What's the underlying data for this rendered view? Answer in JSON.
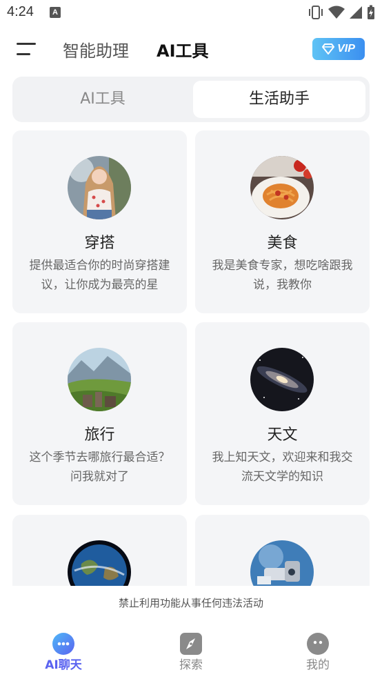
{
  "status_bar": {
    "time": "4:24",
    "notif_letter": "A"
  },
  "header": {
    "tabs": [
      {
        "label": "智能助理"
      },
      {
        "label": "AI工具"
      }
    ],
    "vip_label": "VIP"
  },
  "segment": {
    "items": [
      {
        "label": "AI工具"
      },
      {
        "label": "生活助手"
      }
    ],
    "active_index": 1
  },
  "cards": [
    {
      "title": "穿搭",
      "desc": "提供最适合你的时尚穿搭建议，让你成为最亮的星",
      "icon": "fashion-avatar"
    },
    {
      "title": "美食",
      "desc": "我是美食专家，想吃啥跟我说，我教你",
      "icon": "food-avatar"
    },
    {
      "title": "旅行",
      "desc": "这个季节去哪旅行最合适？问我就对了",
      "icon": "travel-avatar"
    },
    {
      "title": "天文",
      "desc": "我上知天文，欢迎来和我交流天文学的知识",
      "icon": "astronomy-avatar"
    },
    {
      "title": "",
      "desc": "",
      "icon": "earth-avatar"
    },
    {
      "title": "",
      "desc": "",
      "icon": "space-avatar"
    }
  ],
  "notice": "禁止利用功能从事任何违法活动",
  "tabbar": {
    "items": [
      {
        "label": "AI聊天",
        "icon": "chat-icon",
        "active": true
      },
      {
        "label": "探索",
        "icon": "compass-icon",
        "active": false
      },
      {
        "label": "我的",
        "icon": "profile-icon",
        "active": false
      }
    ],
    "active_color": "#5a63f0",
    "inactive_color": "#888888"
  }
}
